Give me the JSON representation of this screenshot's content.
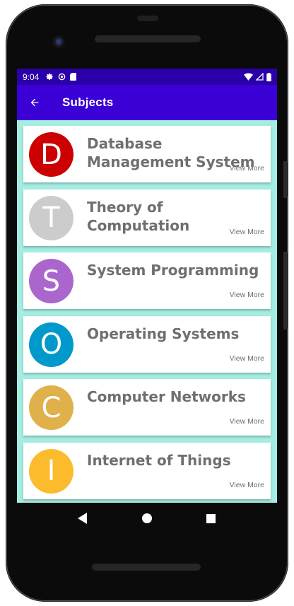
{
  "statusbar": {
    "time": "9:04",
    "left_icons": [
      "settings-icon",
      "sync-icon",
      "sd-card-icon"
    ],
    "right_icons": [
      "wifi-icon",
      "signal-icon",
      "battery-icon"
    ]
  },
  "appbar": {
    "back_icon": "arrow-back-icon",
    "title": "Subjects"
  },
  "subjects": [
    {
      "letter": "D",
      "title": "Database Management System",
      "view_more": "View More",
      "color": "#cc0000"
    },
    {
      "letter": "T",
      "title": "Theory of Computation",
      "view_more": "View More",
      "color": "#cccccc"
    },
    {
      "letter": "S",
      "title": "System Programming",
      "view_more": "View More",
      "color": "#aa66cc"
    },
    {
      "letter": "O",
      "title": "Operating Systems",
      "view_more": "View More",
      "color": "#0099cc"
    },
    {
      "letter": "C",
      "title": "Computer Networks",
      "view_more": "View More",
      "color": "#e0b04a"
    },
    {
      "letter": "I",
      "title": "Internet of Things",
      "view_more": "View More",
      "color": "#fbbb2d"
    }
  ],
  "navbar": {
    "back_icon": "nav-back-icon",
    "home_icon": "nav-home-icon",
    "recents_icon": "nav-recents-icon"
  },
  "colors": {
    "statusbar": "#2a00a8",
    "appbar": "#3a00d6",
    "list_background": "#a5ece2"
  }
}
